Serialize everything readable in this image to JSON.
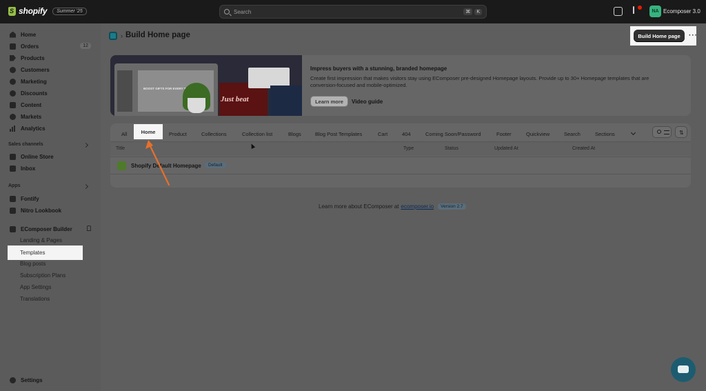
{
  "topbar": {
    "brand": "shopify",
    "edition_badge": "Summer '25",
    "search_placeholder": "Search",
    "shortcut_keys": [
      "⌘",
      "K"
    ],
    "avatar_initials": "NA",
    "store_name": "Ecomposer 3.0",
    "avatar_color": "#36b37e"
  },
  "sidebar": {
    "main_items": [
      {
        "label": "Home",
        "icon": "home-icon"
      },
      {
        "label": "Orders",
        "icon": "orders-icon",
        "count": "12"
      },
      {
        "label": "Products",
        "icon": "products-icon"
      },
      {
        "label": "Customers",
        "icon": "customers-icon"
      },
      {
        "label": "Marketing",
        "icon": "marketing-icon"
      },
      {
        "label": "Discounts",
        "icon": "discounts-icon"
      },
      {
        "label": "Content",
        "icon": "content-icon"
      },
      {
        "label": "Markets",
        "icon": "markets-icon"
      },
      {
        "label": "Analytics",
        "icon": "analytics-icon"
      }
    ],
    "sales_channels_label": "Sales channels",
    "sales_channels": [
      {
        "label": "Online Store",
        "icon": "online-store-icon"
      },
      {
        "label": "Inbox",
        "icon": "inbox-icon"
      }
    ],
    "apps_label": "Apps",
    "apps": [
      {
        "label": "Fontify",
        "icon": "fontify-icon"
      },
      {
        "label": "Nitro Lookbook",
        "icon": "nitro-lookbook-icon"
      }
    ],
    "pinned_app": "EComposer Builder",
    "pinned_sub_items": [
      "Landing & Pages",
      "Templates",
      "Blog posts",
      "Subscription Plans",
      "App Settings",
      "Translations"
    ],
    "settings_label": "Settings"
  },
  "page": {
    "title": "Build Home page",
    "primary_action": "Build Home page"
  },
  "banner": {
    "title": "Impress buyers with a stunning, branded homepage",
    "description": "Create first impression that makes visitors stay using EComposer pre-designed Homepage layouts. Provide up to 30+ Homepage templates that are conversion-focused and mobile-optimized.",
    "learn_more": "Learn more",
    "video_guide": "Video guide",
    "image_text": "BOOST GIFTS FOR EVERY TREND",
    "image_script": "Just beat"
  },
  "tabs": [
    "All",
    "Home",
    "Product",
    "Collections",
    "Collection list",
    "Blogs",
    "Blog Post Templates",
    "Cart",
    "404",
    "Coming Soon/Password",
    "Footer",
    "Quickview",
    "Search",
    "Sections"
  ],
  "table": {
    "columns": [
      "Title",
      "Type",
      "Status",
      "Updated At",
      "Created At"
    ],
    "rows": [
      {
        "title": "Shopify Default Homepage",
        "badge": "Default"
      }
    ]
  },
  "footer": {
    "text": "Learn more about EComposer at",
    "link": "ecomposer.io",
    "version": "Version 2.7"
  },
  "colors": {
    "highlight": "#f5f5f5",
    "annotation_arrow": "#e8702a",
    "primary_button": "#303030",
    "chat_button": "#1d5c70"
  }
}
